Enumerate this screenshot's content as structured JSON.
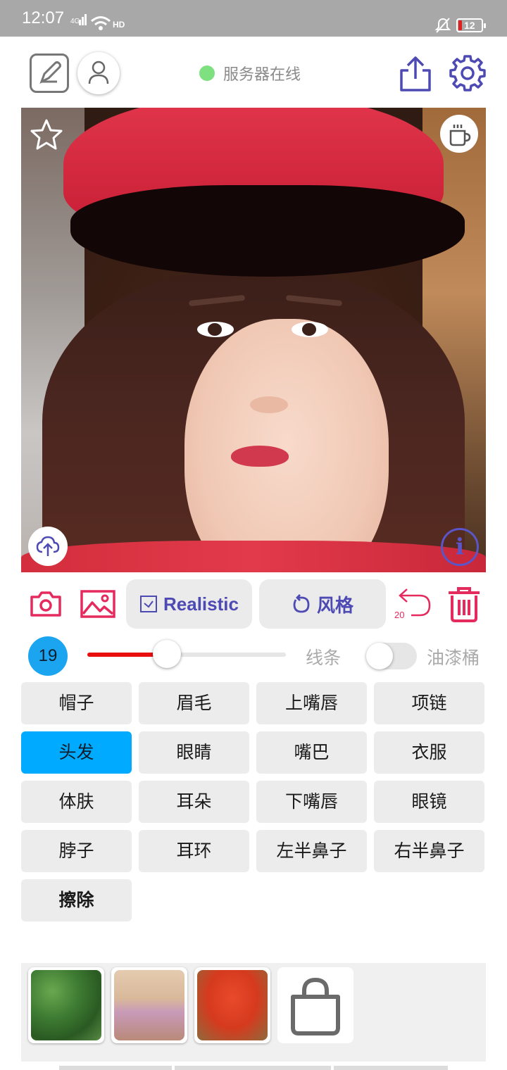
{
  "status_bar": {
    "time": "12:07",
    "network": "4G",
    "hd": "HD",
    "battery": "12"
  },
  "header": {
    "server_status": "服务器在线",
    "server_status_color": "#7ee07e"
  },
  "icons": {
    "edit": "edit-icon",
    "profile": "profile-icon",
    "share": "share-icon",
    "settings": "gear-icon",
    "favorite": "star-icon",
    "coffee": "coffee-icon",
    "upload": "cloud-upload-icon",
    "info": "info-icon",
    "camera": "camera-icon",
    "gallery": "image-icon",
    "undo": "undo-icon",
    "trash": "trash-icon",
    "shop": "shopping-bag-icon"
  },
  "canvas": {
    "info_glyph": "i"
  },
  "toolbar": {
    "realistic_label": "Realistic",
    "style_label": "风格",
    "undo_count": "20",
    "accent": "#4e4ab3",
    "danger": "#e52a5e"
  },
  "brush": {
    "size": "19",
    "slider_fraction": 0.4,
    "line_label": "线条",
    "bucket_label": "油漆桶",
    "bucket_enabled": false
  },
  "parts": [
    {
      "label": "帽子",
      "active": false
    },
    {
      "label": "眉毛",
      "active": false
    },
    {
      "label": "上嘴唇",
      "active": false
    },
    {
      "label": "项链",
      "active": false
    },
    {
      "label": "头发",
      "active": true
    },
    {
      "label": "眼睛",
      "active": false
    },
    {
      "label": "嘴巴",
      "active": false
    },
    {
      "label": "衣服",
      "active": false
    },
    {
      "label": "体肤",
      "active": false
    },
    {
      "label": "耳朵",
      "active": false
    },
    {
      "label": "下嘴唇",
      "active": false
    },
    {
      "label": "眼镜",
      "active": false
    },
    {
      "label": "脖子",
      "active": false
    },
    {
      "label": "耳环",
      "active": false
    },
    {
      "label": "左半鼻子",
      "active": false
    },
    {
      "label": "右半鼻子",
      "active": false
    },
    {
      "label": "擦除",
      "active": false
    }
  ]
}
